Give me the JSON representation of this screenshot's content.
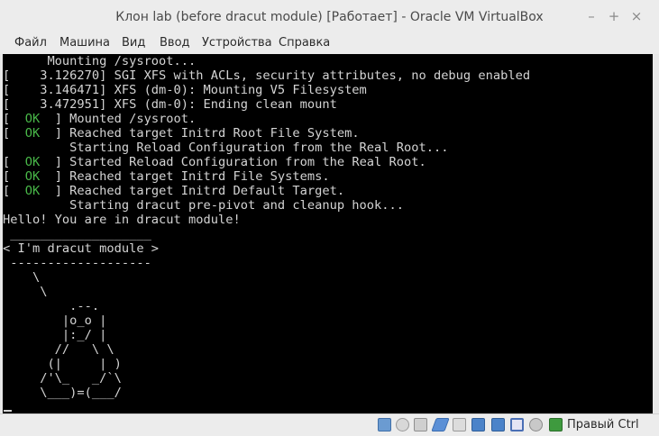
{
  "window": {
    "title": "Клон lab (before dracut module) [Работает] - Oracle VM VirtualBox",
    "minimize_glyph": "–",
    "maximize_glyph": "+",
    "close_glyph": "×"
  },
  "menu": {
    "items": [
      "Файл",
      "Машина",
      "Вид",
      "Ввод",
      "Устройства",
      "Справка"
    ]
  },
  "console": {
    "lines": [
      "      Mounting /sysroot...",
      "[    3.126270] SGI XFS with ACLs, security attributes, no debug enabled",
      "[    3.146471] XFS (dm-0): Mounting V5 Filesystem",
      "[    3.472951] XFS (dm-0): Ending clean mount",
      "[  OK  ] Mounted /sysroot.",
      "[  OK  ] Reached target Initrd Root File System.",
      "         Starting Reload Configuration from the Real Root...",
      "[  OK  ] Started Reload Configuration from the Real Root.",
      "[  OK  ] Reached target Initrd File Systems.",
      "[  OK  ] Reached target Initrd Default Target.",
      "         Starting dracut pre-pivot and cleanup hook...",
      "Hello! You are in dracut module!",
      " ___________________",
      "< I'm dracut module >",
      " -------------------",
      "    \\",
      "     \\",
      "         .--.",
      "        |o_o |",
      "        |:_/ |",
      "       //   \\ \\",
      "      (|     | )",
      "     /'\\_   _/`\\",
      "     \\___)=(___/"
    ],
    "ok_text": "OK"
  },
  "statusbar": {
    "icons": [
      "hard-disk-icon",
      "optical-drive-icon",
      "audio-icon",
      "usb-icon",
      "shared-folders-icon",
      "display-icon",
      "video-capture-icon",
      "virtualization-icon",
      "mouse-integration-icon",
      "keyboard-capture-icon"
    ],
    "host_key": "Правый Ctrl"
  },
  "colors": {
    "console_bg": "#000000",
    "console_text": "#d4d4d4",
    "ok_green": "#49b849",
    "chrome_bg": "#ececec"
  }
}
